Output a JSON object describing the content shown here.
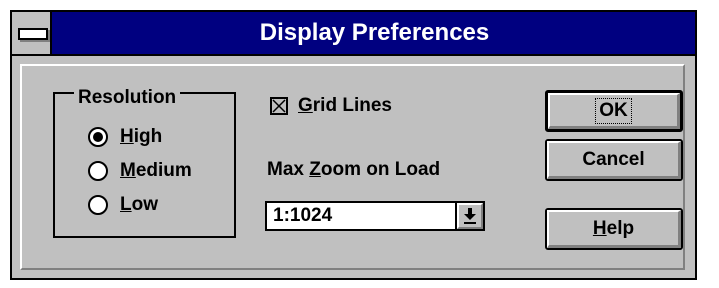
{
  "window": {
    "title": "Display Preferences"
  },
  "resolution": {
    "label": "Resolution",
    "options": [
      {
        "label": "High",
        "mnemonic": "H",
        "rest": "igh",
        "checked": true
      },
      {
        "label": "Medium",
        "mnemonic": "M",
        "rest": "edium",
        "checked": false
      },
      {
        "label": "Low",
        "mnemonic": "L",
        "rest": "ow",
        "checked": false
      }
    ]
  },
  "grid_lines": {
    "label": "Grid Lines",
    "mnemonic": "G",
    "rest": "rid Lines",
    "checked": true
  },
  "max_zoom": {
    "label": "Max Zoom on Load",
    "prefix": "Max ",
    "mnemonic": "Z",
    "rest": "oom on Load",
    "value": "1:1024"
  },
  "buttons": {
    "ok": "OK",
    "cancel": "Cancel",
    "help": "Help",
    "help_mnemonic": "H",
    "help_rest": "elp"
  },
  "icons": {
    "system_menu": "system-menu-icon",
    "dropdown_arrow": "dropdown-arrow-icon",
    "checkbox_x": "checkbox-x-icon"
  },
  "colors": {
    "title_bar": "#000080",
    "face": "#c0c0c0",
    "highlight": "#ffffff",
    "shadow": "#808080",
    "text": "#000000"
  }
}
